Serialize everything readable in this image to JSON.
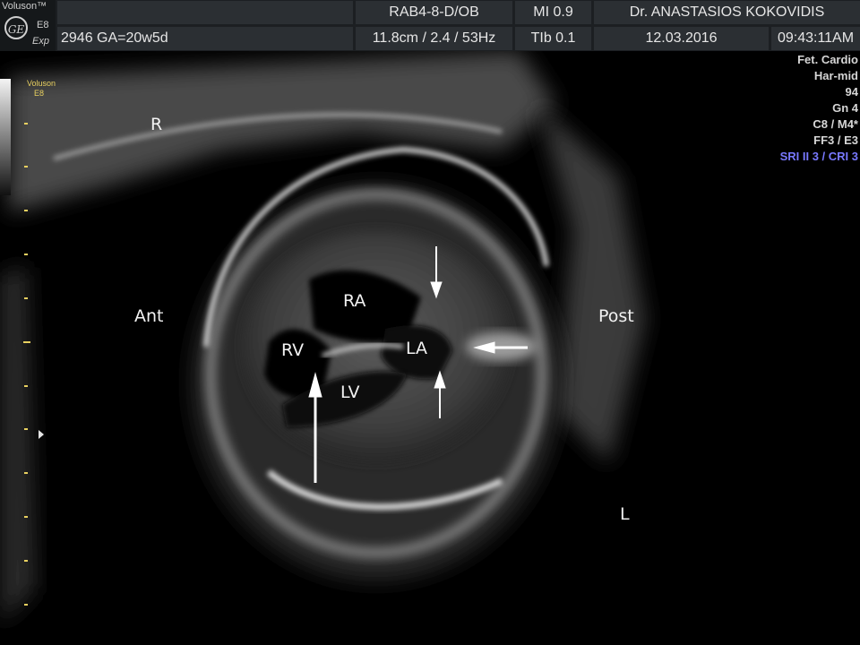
{
  "header": {
    "brand": "Voluson™",
    "logo_text": "GE",
    "model": "E8",
    "mode": "Exp",
    "patient_info": "2946  GA=20w5d",
    "probe": "RAB4-8-D/OB",
    "depth_freq": "11.8cm / 2.4 / 53Hz",
    "mi": "MI  0.9",
    "tib": "TIb  0.1",
    "doctor": "Dr. ANASTASIOS KOKOVIDIS",
    "date": "12.03.2016",
    "time": "09:43:11AM"
  },
  "left_panel": {
    "brand": "Voluson",
    "model": "E8"
  },
  "params": [
    "Fet. Cardio",
    "Har-mid",
    "94",
    "Gn   4",
    "C8 / M4*",
    "FF3 / E3",
    "SRI II 3 / CRI 3"
  ],
  "labels": {
    "r": "R",
    "ant": "Ant",
    "post": "Post",
    "l": "L",
    "ra": "RA",
    "rv": "RV",
    "la": "LA",
    "lv": "LV"
  },
  "colors": {
    "header_bg": "#1c1f22",
    "cell_bg": "#2b2f33",
    "yellow_marks": "#e8d060",
    "sri_text": "#7878ff"
  }
}
